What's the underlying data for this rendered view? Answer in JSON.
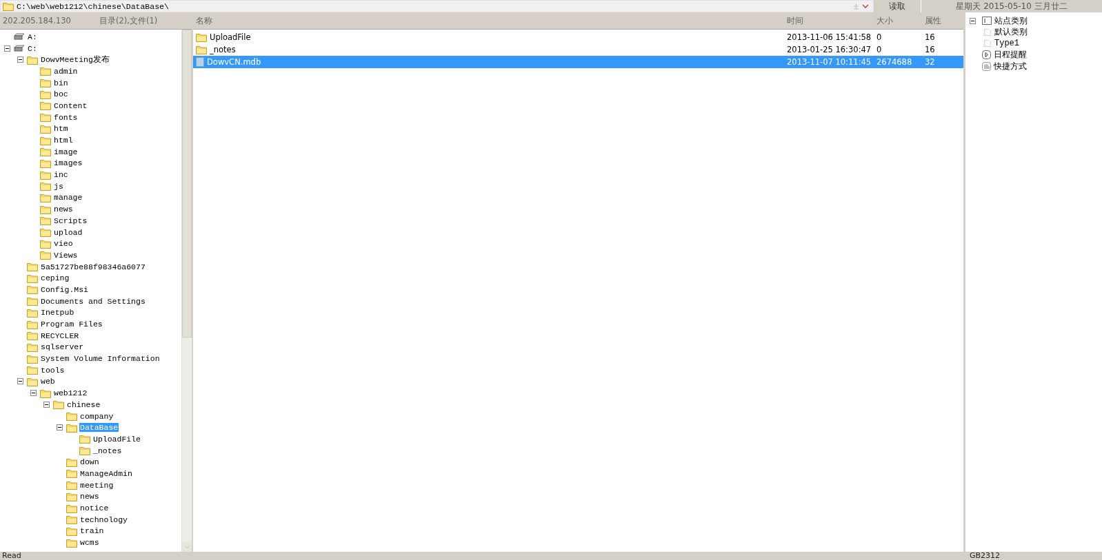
{
  "path_bar": {
    "path": "C:\\web\\web1212\\chinese\\DataBase\\",
    "read_button": "读取",
    "date": "星期天 2015-05-10 三月廿二"
  },
  "left_header": {
    "host": "202.205.184.130",
    "summary": "目录(2),文件(1)"
  },
  "columns": [
    "名称",
    "时间",
    "大小",
    "属性"
  ],
  "files": [
    {
      "kind": "folder",
      "name": "UploadFile",
      "time": "2013-11-06 15:41:58",
      "size": "0",
      "attr": "16",
      "selected": false
    },
    {
      "kind": "folder",
      "name": "_notes",
      "time": "2013-01-25 16:30:47",
      "size": "0",
      "attr": "16",
      "selected": false
    },
    {
      "kind": "file",
      "name": "DowvCN.mdb",
      "time": "2013-11-07 10:11:45",
      "size": "2674688",
      "attr": "32",
      "selected": true
    }
  ],
  "tree": [
    {
      "kind": "drive",
      "label": "A:",
      "selected": false
    },
    {
      "kind": "drive",
      "label": "C:",
      "selected": false,
      "expanded": true,
      "children": [
        {
          "kind": "folder",
          "label": "DowvMeeting发布",
          "selected": false,
          "expanded": true,
          "children": [
            {
              "kind": "folder",
              "label": "admin",
              "selected": false
            },
            {
              "kind": "folder",
              "label": "bin",
              "selected": false
            },
            {
              "kind": "folder",
              "label": "boc",
              "selected": false
            },
            {
              "kind": "folder",
              "label": "Content",
              "selected": false
            },
            {
              "kind": "folder",
              "label": "fonts",
              "selected": false
            },
            {
              "kind": "folder",
              "label": "htm",
              "selected": false
            },
            {
              "kind": "folder",
              "label": "html",
              "selected": false
            },
            {
              "kind": "folder",
              "label": "image",
              "selected": false
            },
            {
              "kind": "folder",
              "label": "images",
              "selected": false
            },
            {
              "kind": "folder",
              "label": "inc",
              "selected": false
            },
            {
              "kind": "folder",
              "label": "js",
              "selected": false
            },
            {
              "kind": "folder",
              "label": "manage",
              "selected": false
            },
            {
              "kind": "folder",
              "label": "news",
              "selected": false
            },
            {
              "kind": "folder",
              "label": "Scripts",
              "selected": false
            },
            {
              "kind": "folder",
              "label": "upload",
              "selected": false
            },
            {
              "kind": "folder",
              "label": "vieo",
              "selected": false
            },
            {
              "kind": "folder",
              "label": "Views",
              "selected": false
            }
          ]
        },
        {
          "kind": "folder",
          "label": "5a51727be88f98346a6077",
          "selected": false
        },
        {
          "kind": "folder",
          "label": "ceping",
          "selected": false
        },
        {
          "kind": "folder",
          "label": "Config.Msi",
          "selected": false
        },
        {
          "kind": "folder",
          "label": "Documents and Settings",
          "selected": false
        },
        {
          "kind": "folder",
          "label": "Inetpub",
          "selected": false
        },
        {
          "kind": "folder",
          "label": "Program Files",
          "selected": false
        },
        {
          "kind": "folder",
          "label": "RECYCLER",
          "selected": false
        },
        {
          "kind": "folder",
          "label": "sqlserver",
          "selected": false
        },
        {
          "kind": "folder",
          "label": "System Volume Information",
          "selected": false
        },
        {
          "kind": "folder",
          "label": "tools",
          "selected": false
        },
        {
          "kind": "folder",
          "label": "web",
          "selected": false,
          "expanded": true,
          "children": [
            {
              "kind": "folder",
              "label": "web1212",
              "selected": false,
              "expanded": true,
              "children": [
                {
                  "kind": "folder",
                  "label": "chinese",
                  "selected": false,
                  "expanded": true,
                  "children": [
                    {
                      "kind": "folder",
                      "label": "company",
                      "selected": false
                    },
                    {
                      "kind": "folder",
                      "label": "DataBase",
                      "selected": true,
                      "expanded": true,
                      "children": [
                        {
                          "kind": "folder",
                          "label": "UploadFile",
                          "selected": false
                        },
                        {
                          "kind": "folder",
                          "label": "_notes",
                          "selected": false
                        }
                      ]
                    },
                    {
                      "kind": "folder",
                      "label": "down",
                      "selected": false
                    },
                    {
                      "kind": "folder",
                      "label": "ManageAdmin",
                      "selected": false
                    },
                    {
                      "kind": "folder",
                      "label": "meeting",
                      "selected": false
                    },
                    {
                      "kind": "folder",
                      "label": "news",
                      "selected": false
                    },
                    {
                      "kind": "folder",
                      "label": "notice",
                      "selected": false
                    },
                    {
                      "kind": "folder",
                      "label": "technology",
                      "selected": false
                    },
                    {
                      "kind": "folder",
                      "label": "train",
                      "selected": false
                    },
                    {
                      "kind": "folder",
                      "label": "wcms",
                      "selected": false
                    }
                  ]
                }
              ]
            }
          ]
        }
      ]
    }
  ],
  "side_tree": [
    {
      "kind": "category",
      "label": "站点类别",
      "expanded": true,
      "children": [
        {
          "kind": "page",
          "label": "默认类别"
        },
        {
          "kind": "page",
          "label": "Type1"
        }
      ]
    },
    {
      "kind": "schedule",
      "label": "日程提醒"
    },
    {
      "kind": "shortcut",
      "label": "快捷方式"
    }
  ],
  "status_bar": {
    "left": "Read",
    "right": "GB2312"
  }
}
